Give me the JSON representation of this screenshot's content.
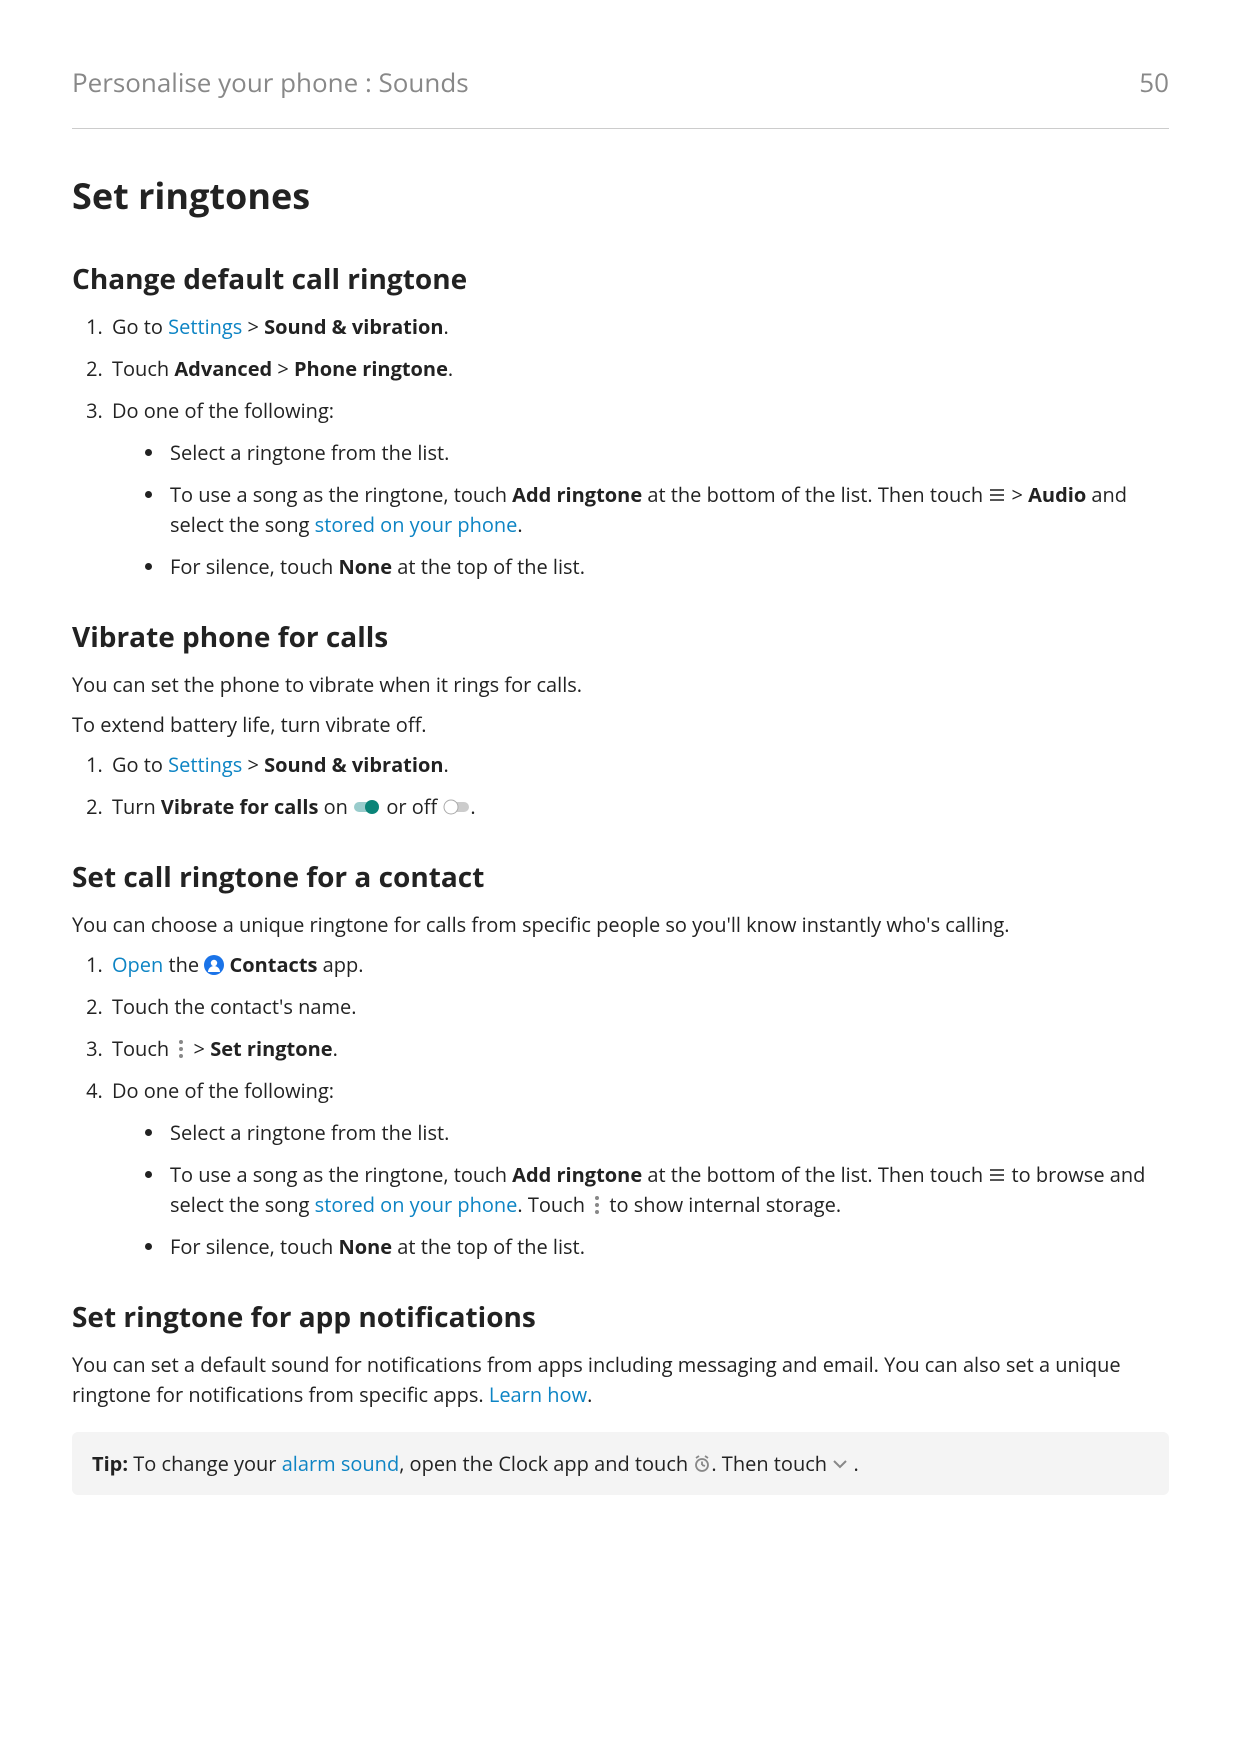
{
  "header": {
    "breadcrumb": "Personalise your phone : Sounds",
    "page_number": "50"
  },
  "title": "Set ringtones",
  "s1": {
    "heading": "Change default call ringtone",
    "goto": "Go to ",
    "settings": "Settings",
    "gt": " > ",
    "sound_vibration": "Sound & vibration",
    "period": ".",
    "touch": "Touch ",
    "advanced": "Advanced",
    "phone_ringtone": "Phone ringtone",
    "do_one": "Do one of the following:",
    "b1": "Select a ringtone from the list.",
    "b2a": "To use a song as the ringtone, touch ",
    "add_ringtone": "Add ringtone",
    "b2b": " at the bottom of the list. Then touch ",
    "audio": "Audio",
    "b2c": " and select the song ",
    "stored": "stored on your phone",
    "b3a": "For silence, touch ",
    "none": "None",
    "b3b": " at the top of the list."
  },
  "s2": {
    "heading": "Vibrate phone for calls",
    "p1": "You can set the phone to vibrate when it rings for calls.",
    "p2": "To extend battery life, turn vibrate off.",
    "goto": "Go to ",
    "settings": "Settings",
    "gt": " > ",
    "sound_vibration": "Sound & vibration",
    "period": ".",
    "turn_a": "Turn ",
    "vibrate_for_calls": "Vibrate for calls",
    "turn_b": " on ",
    "turn_c": " or off ",
    "turn_d": "."
  },
  "s3": {
    "heading": "Set call ringtone for a contact",
    "p1": "You can choose a unique ringtone for calls from specific people so you'll know instantly who's calling.",
    "open": "Open",
    "the": " the ",
    "contacts": "Contacts",
    "app": " app.",
    "step2": "Touch the contact's name.",
    "touch": "Touch ",
    "gt": " > ",
    "set_ringtone": "Set ringtone",
    "period": ".",
    "do_one": "Do one of the following:",
    "b1": "Select a ringtone from the list.",
    "b2a": "To use a song as the ringtone, touch ",
    "add_ringtone": "Add ringtone",
    "b2b": " at the bottom of the list. Then touch ",
    "b2c": " to browse and select the song ",
    "stored": "stored on your phone",
    "b2d": ". Touch ",
    "b2e": " to show internal storage.",
    "b3a": "For silence, touch ",
    "none": "None",
    "b3b": " at the top of the list."
  },
  "s4": {
    "heading": "Set ringtone for app notifications",
    "p1a": "You can set a default sound for notifications from apps including messaging and email. You can also set a unique ringtone for notifications from specific apps. ",
    "learn_how": "Learn how",
    "p1b": "."
  },
  "tip": {
    "label": "Tip:",
    "a": " To change your ",
    "alarm_sound": "alarm sound",
    "b": ", open the Clock app and touch ",
    "c": ". Then touch  ",
    "d": " ."
  }
}
